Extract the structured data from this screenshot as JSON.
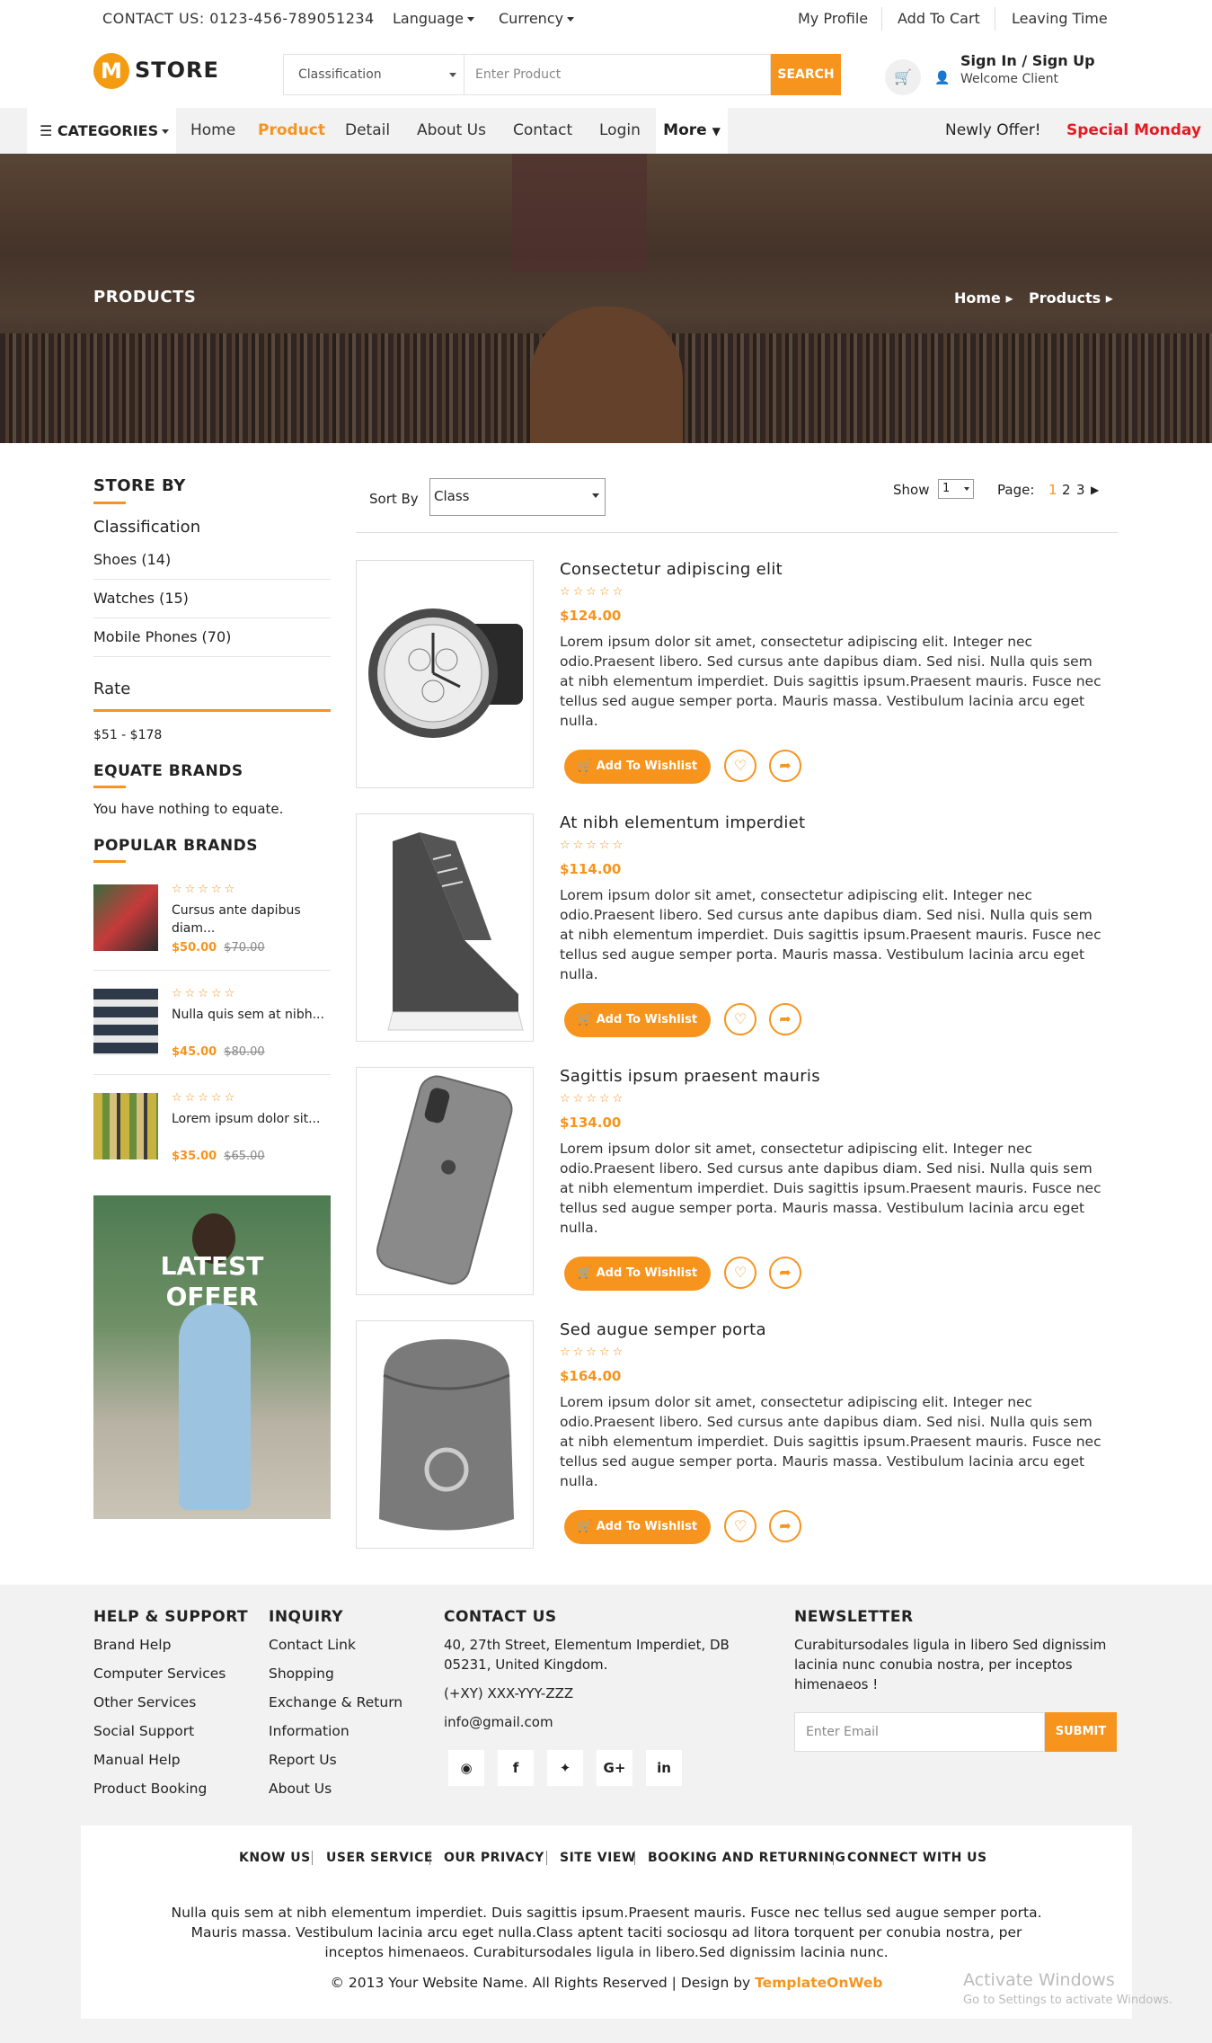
{
  "topbar": {
    "contact": "CONTACT US: 0123-456-789051234",
    "language": "Language",
    "currency": "Currency",
    "links": [
      "My Profile",
      "Add To Cart",
      "Leaving Time"
    ]
  },
  "header": {
    "logo_letter": "M",
    "logo_text": "STORE",
    "search_select": "Classification",
    "search_placeholder": "Enter Product",
    "search_button": "SEARCH",
    "sign_in": "Sign In / Sign Up",
    "welcome": "Welcome Client"
  },
  "nav": {
    "categories": "CATEGORIES",
    "items": [
      "Home",
      "Product",
      "Detail",
      "About Us",
      "Contact",
      "Login"
    ],
    "active": "Product",
    "more": "More",
    "newly": "Newly Offer!",
    "special": "Special Monday"
  },
  "banner": {
    "title": "PRODUCTS",
    "breadcrumb": [
      "Home",
      "Products"
    ]
  },
  "sidebar": {
    "store_by": "STORE BY",
    "classification": "Classification",
    "categories": [
      "Shoes (14)",
      "Watches (15)",
      "Mobile Phones (70)"
    ],
    "rate": "Rate",
    "rate_range": "$51 - $178",
    "equate_title": "EQUATE BRANDS",
    "equate_text": "You have nothing to equate.",
    "popular_title": "POPULAR BRANDS",
    "brands": [
      {
        "title": "Cursus ante dapibus diam...",
        "price": "$50.00",
        "old": "$70.00"
      },
      {
        "title": "Nulla quis sem at nibh...",
        "price": "$45.00",
        "old": "$80.00"
      },
      {
        "title": "Lorem ipsum dolor sit...",
        "price": "$35.00",
        "old": "$65.00"
      }
    ],
    "offer": [
      "LATEST",
      "OFFER"
    ]
  },
  "toolbar": {
    "sort_by": "Sort By",
    "sort_value": "Class",
    "show": "Show",
    "show_value": "1",
    "page": "Page:",
    "pages": [
      "1",
      "2",
      "3"
    ]
  },
  "products": [
    {
      "title": "Consectetur adipiscing elit",
      "price": "$124.00",
      "icon": "watch"
    },
    {
      "title": "At nibh elementum imperdiet",
      "price": "$114.00",
      "icon": "shoe"
    },
    {
      "title": "Sagittis ipsum praesent mauris",
      "price": "$134.00",
      "icon": "phone"
    },
    {
      "title": "Sed augue semper porta",
      "price": "$164.00",
      "icon": "bag"
    }
  ],
  "product_desc": "Lorem ipsum dolor sit amet, consectetur adipiscing elit. Integer nec odio.Praesent libero. Sed cursus ante dapibus diam. Sed nisi. Nulla quis sem at nibh elementum imperdiet. Duis sagittis ipsum.Praesent mauris. Fusce nec tellus sed augue semper porta. Mauris massa. Vestibulum lacinia arcu eget nulla.",
  "wishlist_label": "Add To Wishlist",
  "footer": {
    "help_title": "HELP & SUPPORT",
    "help": [
      "Brand Help",
      "Computer Services",
      "Other Services",
      "Social Support",
      "Manual Help",
      "Product Booking"
    ],
    "inquiry_title": "INQUIRY",
    "inquiry": [
      "Contact Link",
      "Shopping",
      "Exchange & Return",
      "Information",
      "Report Us",
      "About Us"
    ],
    "contact_title": "CONTACT US",
    "address": "40, 27th Street, Elementum Imperdiet, DB 05231, United Kingdom.",
    "phone": "(+XY) XXX-YYY-ZZZ",
    "email": "info@gmail.com",
    "social": [
      "rss-icon",
      "facebook-icon",
      "twitter-icon",
      "google-plus-icon",
      "linkedin-icon"
    ],
    "newsletter_title": "NEWSLETTER",
    "newsletter_text": "Curabitursodales ligula in libero Sed dignissim lacinia nunc conubia nostra, per inceptos himenaeos !",
    "email_placeholder": "Enter Email",
    "submit": "SUBMIT",
    "bottom_links": [
      "KNOW US",
      "USER SERVICE",
      "OUR PRIVACY",
      "SITE VIEW",
      "BOOKING AND RETURNING",
      "CONNECT WITH US"
    ],
    "bottom_text": "Nulla quis sem at nibh elementum imperdiet. Duis sagittis ipsum.Praesent mauris. Fusce nec tellus sed augue semper porta. Mauris massa. Vestibulum lacinia arcu eget nulla.Class aptent taciti sociosqu ad litora torquent per conubia nostra, per inceptos himenaeos. Curabitursodales ligula in libero.Sed dignissim lacinia nunc.",
    "copyright": "© 2013 Your Website Name. All Rights Reserved | Design by",
    "designer": "TemplateOnWeb"
  },
  "os_notice": {
    "title": "Activate Windows",
    "subtitle": "Go to Settings to activate Windows."
  },
  "colors": {
    "accent": "#f7941d",
    "special": "#e31b23"
  }
}
